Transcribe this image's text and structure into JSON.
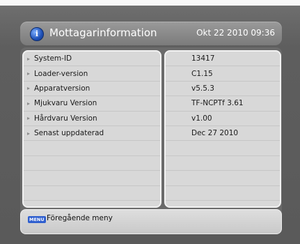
{
  "header": {
    "icon": "info-icon",
    "icon_glyph": "i",
    "title": "Mottagarinformation",
    "datetime": "Okt 22 2010 09:36"
  },
  "info_rows": [
    {
      "label": "System-ID",
      "value": "13417"
    },
    {
      "label": "Loader-version",
      "value": "C1.15"
    },
    {
      "label": "Apparatversion",
      "value": "v5.5.3"
    },
    {
      "label": "Mjukvaru Version",
      "value": "TF-NCPTf 3.61"
    },
    {
      "label": "Hårdvaru Version",
      "value": "v1.00"
    },
    {
      "label": "Senast uppdaterad",
      "value": "Dec 27 2010"
    }
  ],
  "footer": {
    "key_label": "MENU",
    "action_label": "Föregående meny"
  },
  "colors": {
    "icon_blue": "#1d4fb5",
    "menu_key_blue": "#2f5fcf"
  }
}
